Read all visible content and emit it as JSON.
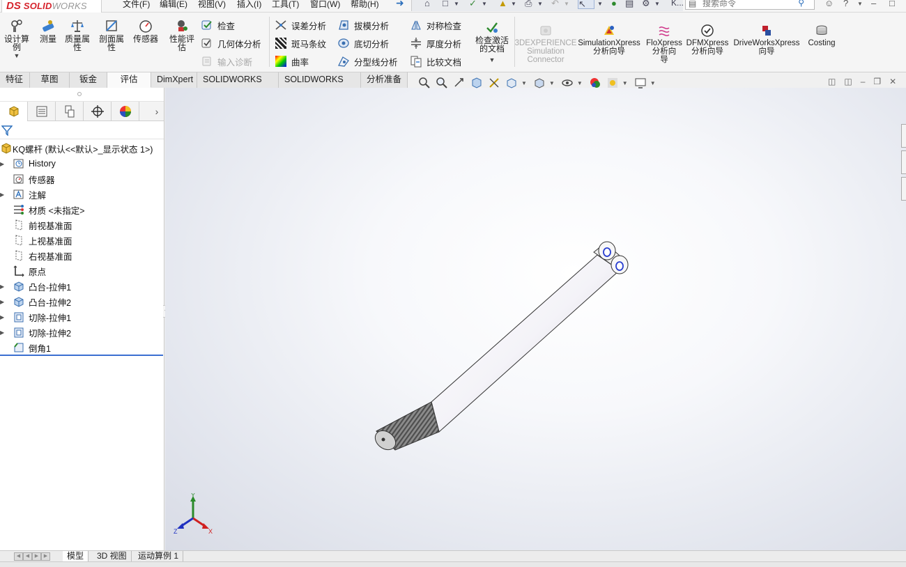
{
  "app": {
    "logo_ds": "DS",
    "logo_name_a": "SOLID",
    "logo_name_b": "WORKS"
  },
  "menu": [
    {
      "id": "file",
      "label": "文件(F)"
    },
    {
      "id": "edit",
      "label": "编辑(E)"
    },
    {
      "id": "view",
      "label": "视图(V)"
    },
    {
      "id": "insert",
      "label": "插入(I)"
    },
    {
      "id": "tools",
      "label": "工具(T)"
    },
    {
      "id": "window",
      "label": "窗口(W)"
    },
    {
      "id": "help",
      "label": "帮助(H)"
    }
  ],
  "search": {
    "placeholder": "搜索命令"
  },
  "user": {
    "initial": "K..."
  },
  "ribbon": {
    "design_study": "设计算例",
    "measure": "测量",
    "mass_properties": "质量属性",
    "section_properties": "剖面属性",
    "sensor": "传感器",
    "performance_evaluation": "性能评估",
    "check": "检查",
    "geometry_analysis": "几何体分析",
    "import_diagnostics": "输入诊断",
    "deviation_analysis": "误差分析",
    "zebra_stripes": "斑马条纹",
    "curvature": "曲率",
    "draft_analysis": "拔模分析",
    "undercut_analysis": "底切分析",
    "parting_line_analysis": "分型线分析",
    "symmetry_check": "对称检查",
    "thickness_analysis": "厚度分析",
    "compare_documents": "比较文档",
    "check_active_document": "检查激活的文档",
    "sim_connector_1": "3DEXPERIENCE",
    "sim_connector_2": "Simulation",
    "sim_connector_3": "Connector",
    "simulationxpress_1": "SimulationXpress",
    "simulationxpress_2": "分析向导",
    "floxpress_1": "FloXpress",
    "floxpress_2": "分析向",
    "floxpress_3": "导",
    "dfmxpress_1": "DFMXpress",
    "dfmxpress_2": "分析向导",
    "driveworksxpress_1": "DriveWorksXpress",
    "driveworksxpress_2": "向导",
    "costing": "Costing"
  },
  "tabs": [
    {
      "id": "features",
      "label": "特征"
    },
    {
      "id": "sketch",
      "label": "草图"
    },
    {
      "id": "sheetmetal",
      "label": "钣金"
    },
    {
      "id": "evaluate",
      "label": "评估",
      "active": true
    },
    {
      "id": "dimxpert",
      "label": "DimXpert"
    },
    {
      "id": "addins",
      "label": "SOLIDWORKS 插件"
    },
    {
      "id": "mbd",
      "label": "SOLIDWORKS MBD"
    },
    {
      "id": "analysis_prep",
      "label": "分析准备"
    }
  ],
  "tree": {
    "root": "KQ螺杆  (默认<<默认>_显示状态 1>)",
    "items": [
      {
        "label": "History",
        "icon": "history-icon",
        "expandable": true
      },
      {
        "label": "传感器",
        "icon": "sensor-icon",
        "expandable": false
      },
      {
        "label": "注解",
        "icon": "annotation-icon",
        "expandable": true
      },
      {
        "label": "材质 <未指定>",
        "icon": "material-icon",
        "expandable": false
      },
      {
        "label": "前视基准面",
        "icon": "plane-icon",
        "expandable": false
      },
      {
        "label": "上视基准面",
        "icon": "plane-icon",
        "expandable": false
      },
      {
        "label": "右视基准面",
        "icon": "plane-icon",
        "expandable": false
      },
      {
        "label": "原点",
        "icon": "origin-icon",
        "expandable": false
      },
      {
        "label": "凸台-拉伸1",
        "icon": "boss-extrude-icon",
        "expandable": true
      },
      {
        "label": "凸台-拉伸2",
        "icon": "boss-extrude-icon",
        "expandable": true
      },
      {
        "label": "切除-拉伸1",
        "icon": "cut-extrude-icon",
        "expandable": true
      },
      {
        "label": "切除-拉伸2",
        "icon": "cut-extrude-icon",
        "expandable": true
      },
      {
        "label": "倒角1",
        "icon": "chamfer-icon",
        "expandable": false
      }
    ]
  },
  "triad": {
    "x": "X",
    "y": "Y",
    "z": "Z"
  },
  "bottom_tabs": [
    {
      "id": "model",
      "label": "模型",
      "active": true
    },
    {
      "id": "view3d",
      "label": "3D 视图"
    },
    {
      "id": "motion",
      "label": "运动算例 1"
    }
  ],
  "colors": {
    "accent": "#d6232c",
    "rollback": "#3a6fd1",
    "link_blue": "#2a6ebb"
  }
}
